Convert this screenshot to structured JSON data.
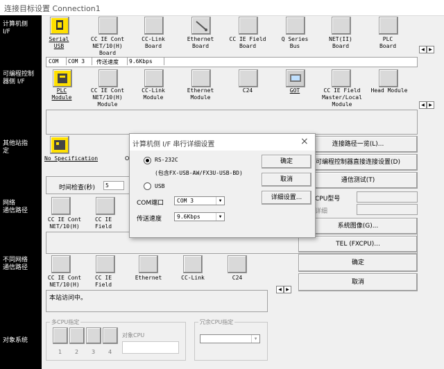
{
  "window": {
    "title": "连接目标设置 Connection1"
  },
  "left_labels": {
    "pc_side": "计算机侧\nI/F",
    "plc_side": "可编程控制\n器侧 I/F",
    "other_station": "其他站指\n定",
    "network_route": "网络\n通信路径",
    "different_network_route": "不同网络\n通信路径",
    "target_system": "对象系统"
  },
  "pc_side_items": [
    {
      "label": "Serial\nUSB",
      "icon": "serial-usb-icon"
    },
    {
      "label": "CC IE Cont\nNET/10(H)\nBoard",
      "icon": "cc-ie-board-icon"
    },
    {
      "label": "CC-Link\nBoard",
      "icon": "cc-link-board-icon"
    },
    {
      "label": "Ethernet\nBoard",
      "icon": "ethernet-board-icon"
    },
    {
      "label": "CC IE Field\nBoard",
      "icon": "cc-ie-field-board-icon"
    },
    {
      "label": "Q Series\nBus",
      "icon": "q-series-bus-icon"
    },
    {
      "label": "NET(II)\nBoard",
      "icon": "net-board-icon"
    },
    {
      "label": "PLC\nBoard",
      "icon": "plc-board-icon"
    }
  ],
  "pc_side_status": {
    "com_label": "COM",
    "com_value": "COM 3",
    "speed_label": "传送速度",
    "speed_value": "9.6Kbps"
  },
  "plc_side_items": [
    {
      "label": "PLC\nModule",
      "icon": "plc-module-icon"
    },
    {
      "label": "CC IE Cont\nNET/10(H)\nModule",
      "icon": "cc-ie-module-icon"
    },
    {
      "label": "CC-Link\nModule",
      "icon": "cc-link-module-icon"
    },
    {
      "label": "Ethernet\nModule",
      "icon": "ethernet-module-icon"
    },
    {
      "label": "C24",
      "icon": "c24-icon"
    },
    {
      "label": "GOT",
      "icon": "got-icon"
    },
    {
      "label": "CC IE Field\nMaster/Local\nModule",
      "icon": "cc-ie-field-master-icon"
    },
    {
      "label": "Head Module",
      "icon": "head-module-icon"
    }
  ],
  "other_station": {
    "label": "No Specification",
    "icon": "no-spec-icon",
    "partial": "O",
    "time_check_label": "时间检查(秒)",
    "time_check_value": "5"
  },
  "network_items": [
    {
      "label": "CC IE Cont\nNET/10(H)"
    },
    {
      "label": "CC IE\nField"
    }
  ],
  "diff_network_items": [
    {
      "label": "CC IE Cont\nNET/10(H)"
    },
    {
      "label": "CC IE\nField"
    },
    {
      "label": "Ethernet"
    },
    {
      "label": "CC-Link"
    },
    {
      "label": "C24"
    }
  ],
  "status_text": "本站访问中。",
  "multi_cpu": {
    "title": "多CPU指定",
    "target_label": "对象CPU",
    "numbers": [
      "1",
      "2",
      "3",
      "4"
    ]
  },
  "redundant_cpu": {
    "title": "冗余CPU指定"
  },
  "right_buttons": {
    "route_list": "连接路径一览(L)...",
    "direct_plc": "可编程控制器直接连接设置(D)",
    "comm_test": "通信测试(T)",
    "cpu_type_label": "CPU型号",
    "detail_label": "详细",
    "system_image": "系统图像(G)...",
    "tel": "TEL (FXCPU)...",
    "ok": "确定",
    "cancel": "取消"
  },
  "dialog": {
    "title": "计算机侧 I/F 串行详细设置",
    "close": "×",
    "rs232c_label": "RS-232C",
    "rs232c_note": "(包含FX-USB-AW/FX3U-USB-BD)",
    "usb_label": "USB",
    "com_port_label": "COM端口",
    "com_port_value": "COM 3",
    "speed_label": "传送速度",
    "speed_value": "9.6Kbps",
    "ok": "确定",
    "cancel": "取消",
    "detail": "详细设置..."
  },
  "colors": {
    "icon_accent": "#ffe000",
    "left_bar": "#000000"
  }
}
